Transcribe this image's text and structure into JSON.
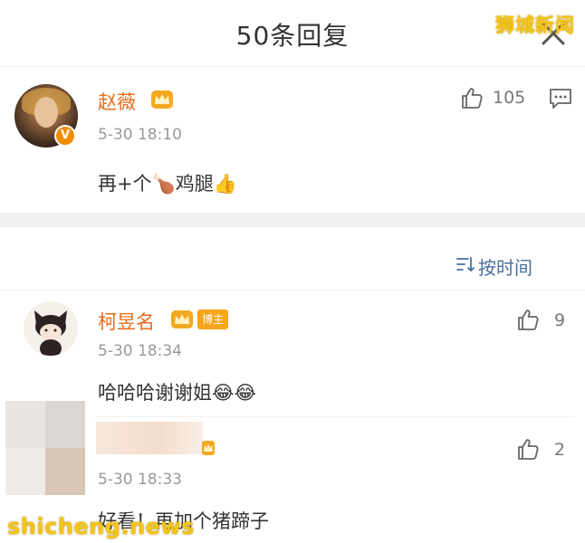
{
  "header": {
    "title": "50条回复"
  },
  "watermark": {
    "top": "狮城新闻",
    "bottom": "shicheng.news"
  },
  "main_comment": {
    "username": "赵薇",
    "time": "5-30 18:10",
    "content": "再+个🍗鸡腿👍",
    "likes": "105",
    "verified_badge": "V"
  },
  "sort": {
    "label": "按时间"
  },
  "replies": [
    {
      "username": "柯昱名",
      "badge": "博主",
      "time": "5-30 18:34",
      "content": "哈哈哈谢谢姐😂😂",
      "likes": "9"
    },
    {
      "username": "",
      "time": "5-30 18:33",
      "content": "好看！再加个猪蹄子",
      "likes": "2"
    }
  ],
  "colors": {
    "username": "#e86b1a",
    "accent_link": "#4a6f9e",
    "crown": "#f3a91f",
    "watermark": "#f5c518"
  },
  "icons": [
    "close-icon",
    "crown-icon",
    "like-icon",
    "reply-icon",
    "sort-icon",
    "verified-badge-icon"
  ]
}
